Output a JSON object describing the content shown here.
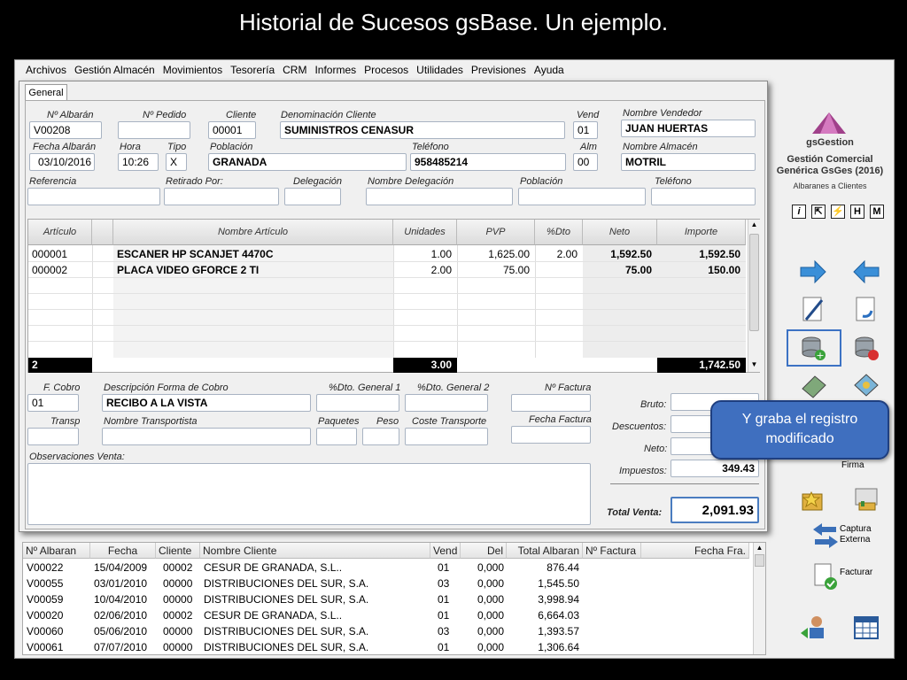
{
  "slide": {
    "title": "Historial de Sucesos gsBase. Un ejemplo."
  },
  "menu": [
    "Archivos",
    "Gestión Almacén",
    "Movimientos",
    "Tesorería",
    "CRM",
    "Informes",
    "Procesos",
    "Utilidades",
    "Previsiones",
    "Ayuda"
  ],
  "tab": "General",
  "header": {
    "albaran_label": "Nº Albarán",
    "albaran": "V00208",
    "pedido_label": "Nº Pedido",
    "pedido": "",
    "cliente_label": "Cliente",
    "cliente": "00001",
    "denominacion_label": "Denominación Cliente",
    "denominacion": "SUMINISTROS CENASUR",
    "vend_label": "Vend",
    "vend": "01",
    "nombre_vendedor_label": "Nombre Vendedor",
    "nombre_vendedor": "JUAN HUERTAS",
    "fecha_label": "Fecha Albarán",
    "fecha": "03/10/2016",
    "hora_label": "Hora",
    "hora": "10:26",
    "tipo_label": "Tipo",
    "tipo": "X",
    "poblacion_label": "Población",
    "poblacion": "GRANADA",
    "telefono_label": "Teléfono",
    "telefono": "958485214",
    "alm_label": "Alm",
    "alm": "00",
    "nombre_almacen_label": "Nombre Almacén",
    "nombre_almacen": "MOTRIL",
    "referencia_label": "Referencia",
    "retirado_label": "Retirado Por:",
    "delegacion_label": "Delegación",
    "nombre_delegacion_label": "Nombre Delegación",
    "poblacion2_label": "Población",
    "telefono2_label": "Teléfono"
  },
  "grid": {
    "headers": [
      "Artículo",
      "Nombre Artículo",
      "Unidades",
      "PVP",
      "%Dto",
      "Neto",
      "Importe"
    ],
    "rows": [
      {
        "articulo": "000001",
        "nombre": "ESCANER HP SCANJET 4470C",
        "unidades": "1.00",
        "pvp": "1,625.00",
        "dto": "2.00",
        "neto": "1,592.50",
        "importe": "1,592.50"
      },
      {
        "articulo": "000002",
        "nombre": "PLACA VIDEO GFORCE 2 TI",
        "unidades": "2.00",
        "pvp": "75.00",
        "dto": "",
        "neto": "75.00",
        "importe": "150.00"
      }
    ],
    "total_count": "2",
    "total_unidades": "3.00",
    "total_importe": "1,742.50"
  },
  "footer": {
    "fcobro_label": "F. Cobro",
    "fcobro": "01",
    "desc_cobro_label": "Descripción Forma de Cobro",
    "desc_cobro": "RECIBO A LA VISTA",
    "dto1_label": "%Dto. General 1",
    "dto2_label": "%Dto. General 2",
    "factura_label": "Nº Factura",
    "transp_label": "Transp",
    "nombre_transp_label": "Nombre Transportista",
    "paquetes_label": "Paquetes",
    "peso_label": "Peso",
    "coste_label": "Coste Transporte",
    "fecha_factura_label": "Fecha Factura",
    "obs_label": "Observaciones Venta:",
    "bruto_label": "Bruto:",
    "descuentos_label": "Descuentos:",
    "neto_label": "Neto:",
    "impuestos_label": "Impuestos:",
    "impuestos": "349.43",
    "total_label": "Total Venta:",
    "total": "2,091.93"
  },
  "list": {
    "headers": [
      "Nº Albaran",
      "Fecha",
      "Cliente",
      "Nombre Cliente",
      "Vend",
      "Del",
      "Total Albaran",
      "Nº Factura",
      "Fecha Fra."
    ],
    "rows": [
      [
        "V00022",
        "15/04/2009",
        "00002",
        "CESUR DE GRANADA, S.L..",
        "01",
        "0,000",
        "876.44"
      ],
      [
        "V00055",
        "03/01/2010",
        "00000",
        "DISTRIBUCIONES DEL SUR, S.A.",
        "03",
        "0,000",
        "1,545.50"
      ],
      [
        "V00059",
        "10/04/2010",
        "00000",
        "DISTRIBUCIONES DEL SUR, S.A.",
        "01",
        "0,000",
        "3,998.94"
      ],
      [
        "V00020",
        "02/06/2010",
        "00002",
        "CESUR DE GRANADA, S.L..",
        "01",
        "0,000",
        "6,664.03"
      ],
      [
        "V00060",
        "05/06/2010",
        "00000",
        "DISTRIBUCIONES DEL SUR, S.A.",
        "03",
        "0,000",
        "1,393.57"
      ],
      [
        "V00061",
        "07/07/2010",
        "00000",
        "DISTRIBUCIONES DEL SUR, S.A.",
        "01",
        "0,000",
        "1,306.64"
      ]
    ]
  },
  "side": {
    "brand": "gsGestion",
    "product_line1": "Gestión Comercial",
    "product_line2": "Genérica GsGes (2016)",
    "module": "Albaranes a Clientes",
    "toolbar": [
      "i",
      "⇱",
      "⚡",
      "H",
      "M"
    ],
    "firma": "Firma",
    "captura1": "Captura",
    "captura2": "Externa",
    "facturar": "Facturar"
  },
  "callout": {
    "line1": "Y graba el registro",
    "line2": "modificado"
  },
  "colors": {
    "accent": "#3f6fbf",
    "brand": "#a0408a"
  }
}
